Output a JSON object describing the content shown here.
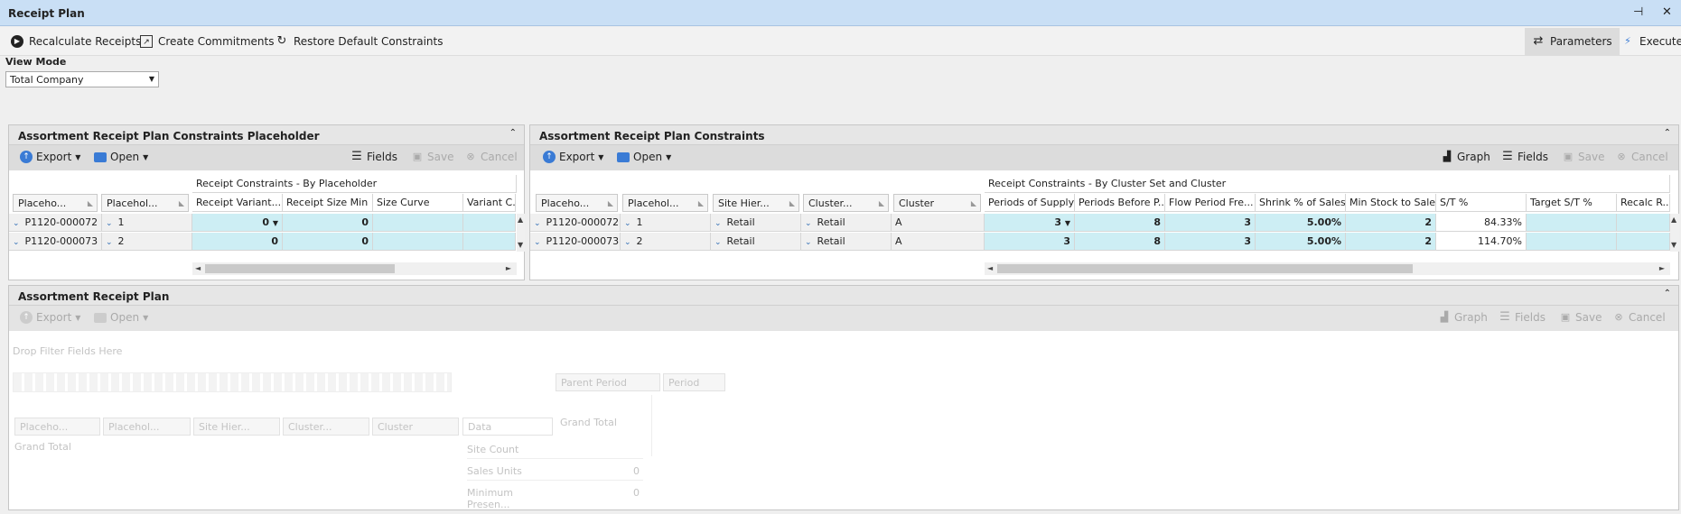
{
  "window": {
    "title": "Receipt Plan",
    "pin_glyph": "⊣",
    "close_glyph": "✕"
  },
  "commands": {
    "recalculate": "Recalculate Receipts",
    "commitments": "Create Commitments",
    "restore": "Restore Default Constraints",
    "parameters": "Parameters",
    "execute": "Execute"
  },
  "view_mode": {
    "label": "View Mode",
    "value": "Total Company"
  },
  "toolbar": {
    "export": "Export",
    "open": "Open",
    "fields": "Fields",
    "save": "Save",
    "cancel": "Cancel",
    "graph": "Graph"
  },
  "left_panel": {
    "title": "Assortment Receipt Plan Constraints Placeholder",
    "group_header": "Receipt Constraints - By Placeholder",
    "row_headers": [
      "Placeho...",
      "Placehol..."
    ],
    "columns": [
      "Receipt Variant...",
      "Receipt Size Min",
      "Size Curve",
      "Variant C..."
    ],
    "rows": [
      {
        "placeholder": "P1120-000072",
        "num": "1",
        "variant": "0",
        "size_min": "0"
      },
      {
        "placeholder": "P1120-000073",
        "num": "2",
        "variant": "0",
        "size_min": "0"
      }
    ]
  },
  "right_panel": {
    "title": "Assortment Receipt Plan Constraints",
    "group_header": "Receipt Constraints - By Cluster Set and Cluster",
    "row_headers": [
      "Placeho...",
      "Placehol...",
      "Site Hier...",
      "Cluster...",
      "Cluster"
    ],
    "columns": [
      "Periods of Supply",
      "Periods Before P...",
      "Flow Period Fre...",
      "Shrink % of Sales",
      "Min Stock to Sales",
      "S/T %",
      "Target S/T %",
      "Recalc R..."
    ],
    "rows": [
      {
        "placeholder": "P1120-000072",
        "num": "1",
        "site": "Retail",
        "cluster_set": "Retail",
        "cluster": "A",
        "pos": "3",
        "pbp": "8",
        "flow": "3",
        "shrink": "5.00%",
        "min_stock": "2",
        "st": "84.33%"
      },
      {
        "placeholder": "P1120-000073",
        "num": "2",
        "site": "Retail",
        "cluster_set": "Retail",
        "cluster": "A",
        "pos": "3",
        "pbp": "8",
        "flow": "3",
        "shrink": "5.00%",
        "min_stock": "2",
        "st": "114.70%"
      }
    ]
  },
  "bottom_panel": {
    "title": "Assortment Receipt Plan",
    "drop_filter": "Drop Filter Fields Here",
    "col_fields": [
      "Parent Period",
      "Period"
    ],
    "grand_total_col": "Grand Total",
    "row_fields": [
      "Placeho...",
      "Placehol...",
      "Site Hier...",
      "Cluster...",
      "Cluster"
    ],
    "data_label": "Data",
    "grand_total_row": "Grand Total",
    "data_items": [
      {
        "label": "Site Count",
        "value": ""
      },
      {
        "label": "Sales Units",
        "value": "0"
      },
      {
        "label": "Minimum Presen...",
        "value": "0"
      }
    ]
  }
}
